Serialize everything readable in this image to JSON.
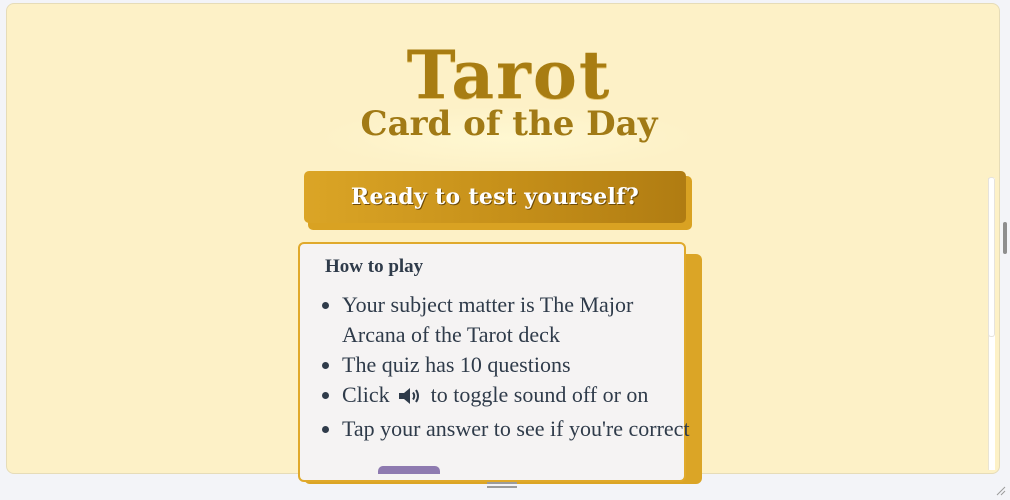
{
  "header": {
    "title": "Tarot",
    "subtitle": "Card of the Day"
  },
  "start_button": {
    "label": "Ready to test yourself?"
  },
  "instructions": {
    "title": "How to play",
    "items": [
      "Your subject matter is The Major Arcana of the Tarot deck",
      "The quiz has 10 questions",
      {
        "before": "Click",
        "icon": "speaker-icon",
        "after": "to toggle sound off or on"
      },
      "Tap your answer to see if you're correct"
    ]
  },
  "colors": {
    "background": "#fdf1c7",
    "gold": "#dba526",
    "gold_dark": "#a87d12",
    "card_bg": "#f5f3f3",
    "text": "#2f3b4a"
  }
}
